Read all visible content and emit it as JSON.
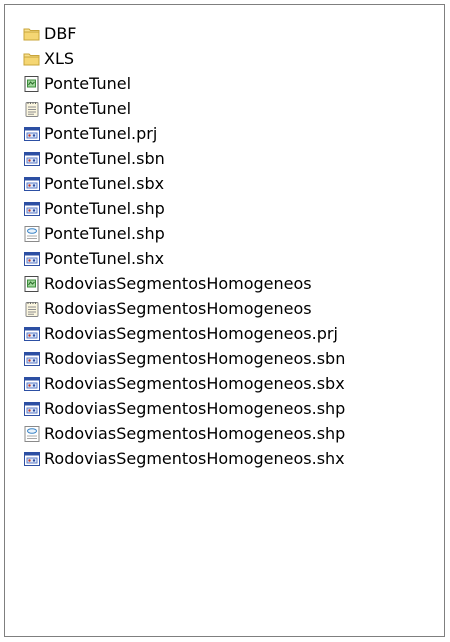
{
  "files": [
    {
      "name": "DBF",
      "icon": "folder-icon"
    },
    {
      "name": "XLS",
      "icon": "folder-icon"
    },
    {
      "name": "PonteTunel",
      "icon": "green-doc-icon"
    },
    {
      "name": "PonteTunel",
      "icon": "notepad-icon"
    },
    {
      "name": "PonteTunel.prj",
      "icon": "app-window-icon"
    },
    {
      "name": "PonteTunel.sbn",
      "icon": "app-window-icon"
    },
    {
      "name": "PonteTunel.sbx",
      "icon": "app-window-icon"
    },
    {
      "name": "PonteTunel.shp",
      "icon": "app-window-icon"
    },
    {
      "name": "PonteTunel.shp",
      "icon": "xml-doc-icon"
    },
    {
      "name": "PonteTunel.shx",
      "icon": "app-window-icon"
    },
    {
      "name": "RodoviasSegmentosHomogeneos",
      "icon": "green-doc-icon"
    },
    {
      "name": "RodoviasSegmentosHomogeneos",
      "icon": "notepad-icon"
    },
    {
      "name": "RodoviasSegmentosHomogeneos.prj",
      "icon": "app-window-icon"
    },
    {
      "name": "RodoviasSegmentosHomogeneos.sbn",
      "icon": "app-window-icon"
    },
    {
      "name": "RodoviasSegmentosHomogeneos.sbx",
      "icon": "app-window-icon"
    },
    {
      "name": "RodoviasSegmentosHomogeneos.shp",
      "icon": "app-window-icon"
    },
    {
      "name": "RodoviasSegmentosHomogeneos.shp",
      "icon": "xml-doc-icon"
    },
    {
      "name": "RodoviasSegmentosHomogeneos.shx",
      "icon": "app-window-icon"
    }
  ],
  "colors": {
    "border": "#7f7f7f",
    "folder": "#f5d673",
    "app_blue": "#2c4fa3",
    "green": "#3c8c3c"
  }
}
